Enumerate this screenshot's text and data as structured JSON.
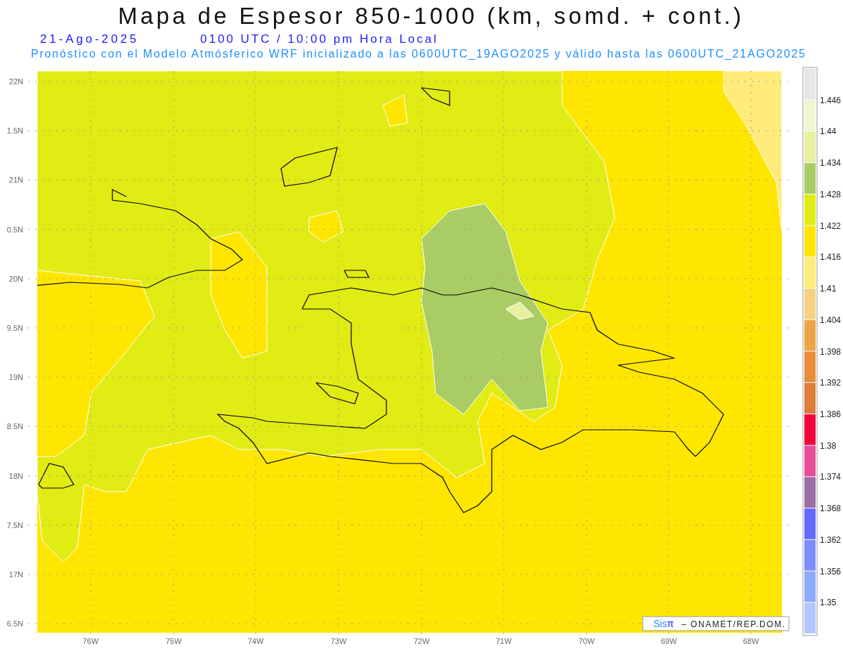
{
  "title": "Mapa de Espesor 850-1000 (km, somd. + cont.)",
  "date": "21-Ago-2025",
  "time": "0100 UTC / 10:00 pm Hora Local",
  "forecast_note": "Pronóstico con el Modelo Atmósferico WRF inicializado a las 0600UTC_19AGO2025 y válido hasta las  0600UTC_21AGO2025",
  "y_axis_labels": [
    "22N",
    "1.5N",
    "21N",
    "0.5N",
    "20N",
    "9.5N",
    "19N",
    "8.5N",
    "18N",
    "7.5N",
    "17N",
    "6.5N"
  ],
  "x_axis_labels": [
    "76W",
    "75W",
    "74W",
    "73W",
    "72W",
    "71W",
    "70W",
    "69W",
    "68W"
  ],
  "legend": {
    "swatches": [
      {
        "color": "#e6e6e6"
      },
      {
        "color": "#f0f5d2"
      },
      {
        "color": "#e6f0a0"
      },
      {
        "color": "#aacc64"
      },
      {
        "color": "#e1eb14"
      },
      {
        "color": "#ffe600"
      },
      {
        "color": "#ffeb7a"
      },
      {
        "color": "#f5d282"
      },
      {
        "color": "#eba546"
      },
      {
        "color": "#e68c3c"
      },
      {
        "color": "#dc7d3c"
      },
      {
        "color": "#f0053c"
      },
      {
        "color": "#e6509b"
      },
      {
        "color": "#9b6ea5"
      },
      {
        "color": "#6469ff"
      },
      {
        "color": "#7d8cff"
      },
      {
        "color": "#8caaff"
      },
      {
        "color": "#b4c8ff"
      }
    ],
    "labels": [
      "1.446",
      "1.44",
      "1.434",
      "1.428",
      "1.422",
      "1.416",
      "1.41",
      "1.404",
      "1.398",
      "1.392",
      "1.386",
      "1.38",
      "1.374",
      "1.368",
      "1.362",
      "1.356",
      "1.35"
    ]
  },
  "credit": {
    "brand_parts": [
      {
        "text": "Sis",
        "color": "#1e90ff"
      },
      {
        "text": "π",
        "color": "#1a1aff"
      }
    ],
    "text": "– ONAMET/REP.DOM."
  }
}
